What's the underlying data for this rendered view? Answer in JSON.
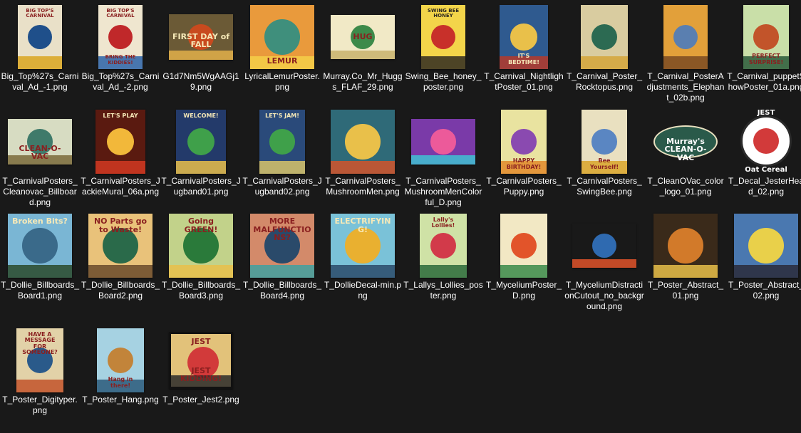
{
  "files": [
    {
      "name": "Big_Top%27s_Carnival_Ad_-1.png",
      "thumb": {
        "bg": "#e9e0c8",
        "accent": "#1f4f8a",
        "accent2": "#d9a520",
        "w": 62,
        "h": 90,
        "top": "BIG TOP'S CARNIVAL",
        "mid": "",
        "bot": ""
      }
    },
    {
      "name": "Big_Top%27s_Carnival_Ad_-2.png",
      "thumb": {
        "bg": "#efe6cf",
        "accent": "#c0282a",
        "accent2": "#2a62a8",
        "w": 62,
        "h": 90,
        "top": "BIG TOP'S CARNIVAL",
        "mid": "",
        "bot": "BRING THE KIDDIES!"
      }
    },
    {
      "name": "G1d7Nm5WgAAGj19.png",
      "thumb": {
        "bg": "#6b5a36",
        "accent": "#c84a1e",
        "accent2": "#e2b04a",
        "w": 90,
        "h": 64,
        "top": "",
        "mid": "FIRST DAY of FALL",
        "bot": ""
      }
    },
    {
      "name": "LyricalLemurPoster.png",
      "thumb": {
        "bg": "#e99a3c",
        "accent": "#3f8f7c",
        "accent2": "#f4cf48",
        "w": 90,
        "h": 90,
        "top": "",
        "mid": "",
        "bot": "LEMUR"
      }
    },
    {
      "name": "Murray.Co_Mr_Huggs_FLAF_29.png",
      "thumb": {
        "bg": "#f1e9c6",
        "accent": "#3d8a4a",
        "accent2": "#c9b36c",
        "w": 90,
        "h": 62,
        "top": "",
        "mid": "HUG",
        "bot": ""
      }
    },
    {
      "name": "Swing_Bee_honey_poster.png",
      "thumb": {
        "bg": "#f3d54a",
        "accent": "#c8302a",
        "accent2": "#2f2a20",
        "w": 62,
        "h": 90,
        "top": "SWING BEE HONEY",
        "mid": "",
        "bot": ""
      }
    },
    {
      "name": "T_Carnival_NightlightPoster_01.png",
      "thumb": {
        "bg": "#2f5a8f",
        "accent": "#e9c04a",
        "accent2": "#b53a2a",
        "w": 68,
        "h": 90,
        "top": "",
        "mid": "",
        "bot": "IT'S BEDTIME!"
      }
    },
    {
      "name": "T_Carnival_Poster_Rocktopus.png",
      "thumb": {
        "bg": "#d9cca0",
        "accent": "#2c6a52",
        "accent2": "#d3a43a",
        "w": 66,
        "h": 90,
        "top": "",
        "mid": "",
        "bot": ""
      }
    },
    {
      "name": "T_Carnival_PosterAdjustments_Elephant_02b.png",
      "thumb": {
        "bg": "#e2a03a",
        "accent": "#5a7fb0",
        "accent2": "#7a4a22",
        "w": 62,
        "h": 90,
        "top": "",
        "mid": "",
        "bot": ""
      }
    },
    {
      "name": "T_Carnival_puppetShowPoster_01a.png",
      "thumb": {
        "bg": "#c9dfa8",
        "accent": "#c2542a",
        "accent2": "#2a5a3a",
        "w": 64,
        "h": 90,
        "top": "",
        "mid": "",
        "bot": "PERFECT SURPRISE!"
      }
    },
    {
      "name": "T_CarnivalPosters_Cleanovac_Billboard.png",
      "thumb": {
        "bg": "#d7dcc2",
        "accent": "#3f7a6a",
        "accent2": "#7a6a3a",
        "w": 90,
        "h": 64,
        "top": "",
        "mid": "",
        "bot": "CLEAN-O-VAC"
      }
    },
    {
      "name": "T_CarnivalPosters_JackieMural_06a.png",
      "thumb": {
        "bg": "#5a1a10",
        "accent": "#f2b83a",
        "accent2": "#d23a22",
        "w": 70,
        "h": 90,
        "top": "LET'S PLAY",
        "mid": "",
        "bot": ""
      }
    },
    {
      "name": "T_CarnivalPosters_Jugband01.png",
      "thumb": {
        "bg": "#233a6a",
        "accent": "#3fa04a",
        "accent2": "#e9c04a",
        "w": 70,
        "h": 90,
        "top": "WELCOME!",
        "mid": "",
        "bot": ""
      }
    },
    {
      "name": "T_CarnivalPosters_Jugband02.png",
      "thumb": {
        "bg": "#2a4a7a",
        "accent": "#3fa04a",
        "accent2": "#d8c46a",
        "w": 64,
        "h": 90,
        "top": "LET'S JAM!",
        "mid": "",
        "bot": ""
      }
    },
    {
      "name": "T_CarnivalPosters_MushroomMen.png",
      "thumb": {
        "bg": "#2f6a78",
        "accent": "#e9c04a",
        "accent2": "#d2542a",
        "w": 90,
        "h": 90,
        "top": "",
        "mid": "",
        "bot": ""
      }
    },
    {
      "name": "T_CarnivalPosters_MushroomMenColorful_D.png",
      "thumb": {
        "bg": "#7a3aa8",
        "accent": "#ec5a9a",
        "accent2": "#3fc2d2",
        "w": 90,
        "h": 64,
        "top": "",
        "mid": "",
        "bot": ""
      }
    },
    {
      "name": "T_CarnivalPosters_Puppy.png",
      "thumb": {
        "bg": "#e9e3a0",
        "accent": "#8a4ab0",
        "accent2": "#e28a2a",
        "w": 64,
        "h": 90,
        "top": "",
        "mid": "",
        "bot": "HAPPY BIRTHDAY!"
      }
    },
    {
      "name": "T_CarnivalPosters_SwingBee.png",
      "thumb": {
        "bg": "#e9e0c0",
        "accent": "#5a86c2",
        "accent2": "#d9a52a",
        "w": 64,
        "h": 90,
        "top": "",
        "mid": "",
        "bot": "Bee Yourself!"
      }
    },
    {
      "name": "T_CleanOVac_color_logo_01.png",
      "thumb": {
        "bg": "#191919",
        "accent": "#2a5a4a",
        "accent2": "#ffffff",
        "w": 90,
        "h": 62,
        "top": "",
        "mid": "Murray's CLEAN-O-VAC",
        "bot": "",
        "oval": true
      }
    },
    {
      "name": "T_Decal_JesterHead_02.png",
      "thumb": {
        "bg": "#191919",
        "accent": "#ffffff",
        "accent2": "#d23a3a",
        "w": 84,
        "h": 90,
        "top": "JEST",
        "mid": "",
        "bot": "Oat Cereal",
        "round": true
      }
    },
    {
      "name": "T_Dollie_Billboards_Board1.png",
      "thumb": {
        "bg": "#7ab6d4",
        "accent": "#3a6a8a",
        "accent2": "#2a4a2a",
        "w": 90,
        "h": 90,
        "top": "Broken Bits?",
        "mid": "",
        "bot": ""
      }
    },
    {
      "name": "T_Dollie_Billboards_Board2.png",
      "thumb": {
        "bg": "#e9c27a",
        "accent": "#2a6a4a",
        "accent2": "#6a4a2a",
        "w": 90,
        "h": 90,
        "top": "NO Parts go to Waste!",
        "mid": "",
        "bot": ""
      }
    },
    {
      "name": "T_Dollie_Billboards_Board3.png",
      "thumb": {
        "bg": "#c2d28a",
        "accent": "#2a7a3a",
        "accent2": "#e9c04a",
        "w": 90,
        "h": 90,
        "top": "Going GREEN!",
        "mid": "",
        "bot": ""
      }
    },
    {
      "name": "T_Dollie_Billboards_Board4.png",
      "thumb": {
        "bg": "#d38a6a",
        "accent": "#2a4a6a",
        "accent2": "#3fa0a0",
        "w": 90,
        "h": 90,
        "top": "MORE MALFUNCTIONS?",
        "mid": "",
        "bot": ""
      }
    },
    {
      "name": "T_DollieDecal-min.png",
      "thumb": {
        "bg": "#7ac2d8",
        "accent": "#e9b030",
        "accent2": "#2a4a6a",
        "w": 90,
        "h": 90,
        "top": "ELECTRIFYING!",
        "mid": "",
        "bot": ""
      }
    },
    {
      "name": "T_Lallys_Lollies_poster.png",
      "thumb": {
        "bg": "#cfe2a6",
        "accent": "#d23a4a",
        "accent2": "#2a6a3a",
        "w": 66,
        "h": 90,
        "top": "Lally's Lollies!",
        "mid": "",
        "bot": ""
      }
    },
    {
      "name": "T_MyceliumPoster_D.png",
      "thumb": {
        "bg": "#f2e8c4",
        "accent": "#e2542a",
        "accent2": "#3a8a4a",
        "w": 66,
        "h": 90,
        "top": "",
        "mid": "",
        "bot": ""
      }
    },
    {
      "name": "T_MyceliumDistractionCutout_no_background.png",
      "thumb": {
        "bg": "#191919",
        "accent": "#2f6ab0",
        "accent2": "#e2542a",
        "w": 90,
        "h": 62,
        "top": "",
        "mid": "",
        "bot": ""
      }
    },
    {
      "name": "T_Poster_Abstract_01.png",
      "thumb": {
        "bg": "#3a2a1a",
        "accent": "#d27a2a",
        "accent2": "#e9c04a",
        "w": 90,
        "h": 90,
        "top": "",
        "mid": "",
        "bot": ""
      }
    },
    {
      "name": "T_Poster_Abstract_02.png",
      "thumb": {
        "bg": "#4a78b0",
        "accent": "#e9d04a",
        "accent2": "#2a2a3a",
        "w": 90,
        "h": 90,
        "top": "",
        "mid": "",
        "bot": ""
      }
    },
    {
      "name": "T_Poster_Digityper.png",
      "thumb": {
        "bg": "#e2d2a8",
        "accent": "#2a5a8a",
        "accent2": "#c2542a",
        "w": 66,
        "h": 90,
        "top": "HAVE A MESSAGE FOR SOMEONE?",
        "mid": "",
        "bot": ""
      }
    },
    {
      "name": "T_Poster_Hang.png",
      "thumb": {
        "bg": "#a6d2e2",
        "accent": "#c2843a",
        "accent2": "#2a5a7a",
        "w": 66,
        "h": 90,
        "top": "",
        "mid": "",
        "bot": "Hang in there!"
      }
    },
    {
      "name": "T_Poster_Jest2.png",
      "thumb": {
        "bg": "#e2c27a",
        "accent": "#d23a3a",
        "accent2": "#2a2a2a",
        "w": 90,
        "h": 80,
        "top": "JEST",
        "mid": "",
        "bot": "JEST KIDDING!",
        "frame": true
      }
    }
  ]
}
